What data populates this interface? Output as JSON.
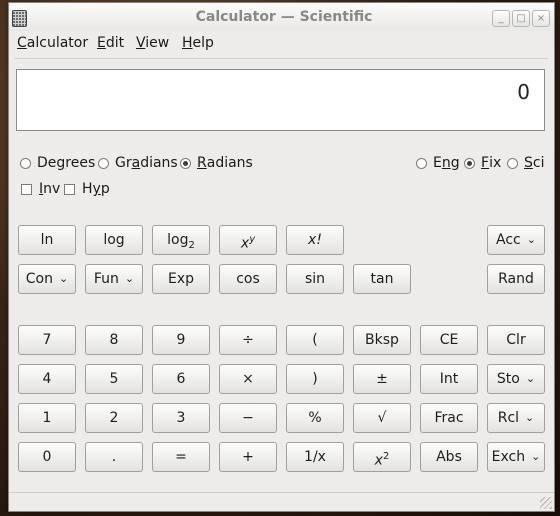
{
  "window": {
    "title": "Calculator — Scientific"
  },
  "menu": {
    "calculator": {
      "u": "C",
      "rest": "alculator"
    },
    "edit": {
      "u": "E",
      "rest": "dit"
    },
    "view": {
      "u": "V",
      "rest": "iew"
    },
    "help": {
      "u": "H",
      "rest": "elp"
    }
  },
  "display": {
    "value": "0"
  },
  "angle_units": {
    "degrees": {
      "pre": "De",
      "u": "g",
      "post": "rees",
      "selected": false
    },
    "gradians": {
      "pre": "Gr",
      "u": "a",
      "post": "dians",
      "selected": false
    },
    "radians": {
      "pre": "",
      "u": "R",
      "post": "adians",
      "selected": true
    }
  },
  "display_modes": {
    "eng": {
      "pre": "E",
      "u": "n",
      "post": "g",
      "selected": false
    },
    "fix": {
      "pre": "",
      "u": "F",
      "post": "ix",
      "selected": true
    },
    "sci": {
      "pre": "",
      "u": "S",
      "post": "ci",
      "selected": false
    }
  },
  "modifiers": {
    "inv": {
      "pre": "",
      "u": "I",
      "post": "nv"
    },
    "hyp": {
      "pre": "H",
      "u": "y",
      "post": "p"
    }
  },
  "buttons": {
    "ln": "ln",
    "log": "log",
    "log2_base": "log",
    "log2_sub": "2",
    "xy_base": "x",
    "xy_sup": "y",
    "fact": "x!",
    "acc": "Acc",
    "con": "Con",
    "fun": "Fun",
    "exp": "Exp",
    "cos": "cos",
    "sin": "sin",
    "tan": "tan",
    "rand": "Rand",
    "d7": "7",
    "d8": "8",
    "d9": "9",
    "div": "÷",
    "lparen": "(",
    "bksp": "Bksp",
    "ce": "CE",
    "clr": "Clr",
    "d4": "4",
    "d5": "5",
    "d6": "6",
    "mul": "×",
    "rparen": ")",
    "pm": "±",
    "int": "Int",
    "sto": "Sto",
    "d1": "1",
    "d2": "2",
    "d3": "3",
    "minus": "−",
    "pct": "%",
    "sqrt": "√",
    "frac": "Frac",
    "rcl": "Rcl",
    "d0": "0",
    "dot": ".",
    "eq": "=",
    "plus": "+",
    "recip": "1/x",
    "sq_base": "x",
    "sq_sup": "2",
    "abs": "Abs",
    "exch": "Exch"
  },
  "icons": {
    "app": "calculator-icon",
    "dropdown": "chevron-down-icon"
  }
}
